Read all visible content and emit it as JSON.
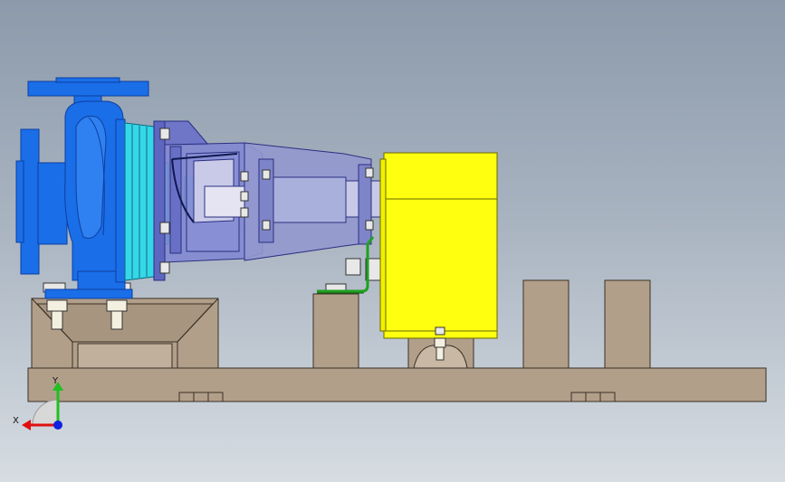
{
  "colors": {
    "background_top": "#8c9aab",
    "background_bottom": "#d6dce2",
    "pump_blue": "#1a6ee8",
    "pump_blue_dark": "#0c3fa0",
    "cyan_part": "#35d8e8",
    "bracket_lavender": "#6f76c8",
    "coupling_guard": "#9498cf",
    "motor_yellow": "#ffff10",
    "base_tan": "#b29f8a",
    "base_outline": "#3a3126",
    "triad_x": "#e01010",
    "triad_y": "#20c020",
    "triad_z": "#1020e0"
  },
  "triad": {
    "x_label": "X",
    "y_label": "Y"
  },
  "icons": {
    "triad": "coordinate-triad-icon"
  }
}
